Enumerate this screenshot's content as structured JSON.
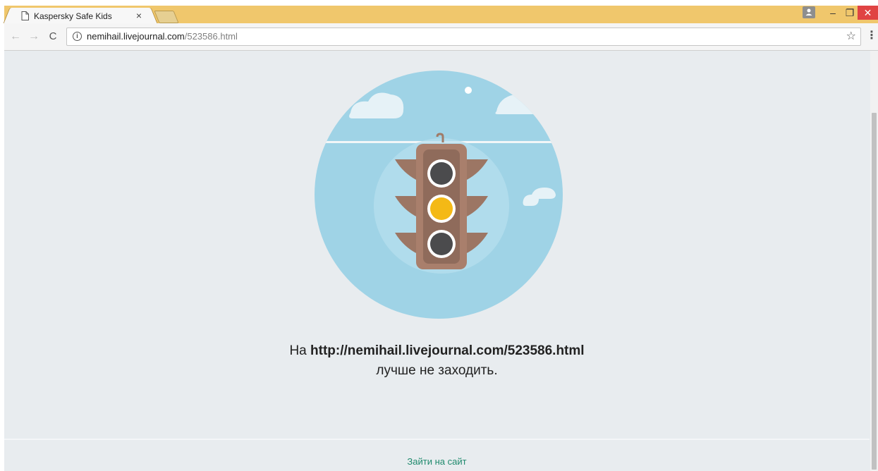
{
  "browser": {
    "tab_title": "Kaspersky Safe Kids",
    "tab_close": "×",
    "url_host": "nemihail.livejournal.com",
    "url_path": "/523586.html",
    "back": "←",
    "forward": "→",
    "reload": "C",
    "info": "i",
    "star": "☆",
    "menu": "⋮",
    "minimize": "–",
    "maximize": "❐",
    "close": "✕"
  },
  "page": {
    "message_prefix": "На ",
    "blocked_url": "http://nemihail.livejournal.com/523586.html",
    "message_suffix": "лучше не заходить.",
    "visit_link": "Зайти на сайт"
  },
  "colors": {
    "titlebar": "#f0c76c",
    "page_bg": "#e8ecef",
    "sky": "#9fd3e6",
    "link": "#1f8a6d",
    "light_yellow": "#f4b916"
  }
}
